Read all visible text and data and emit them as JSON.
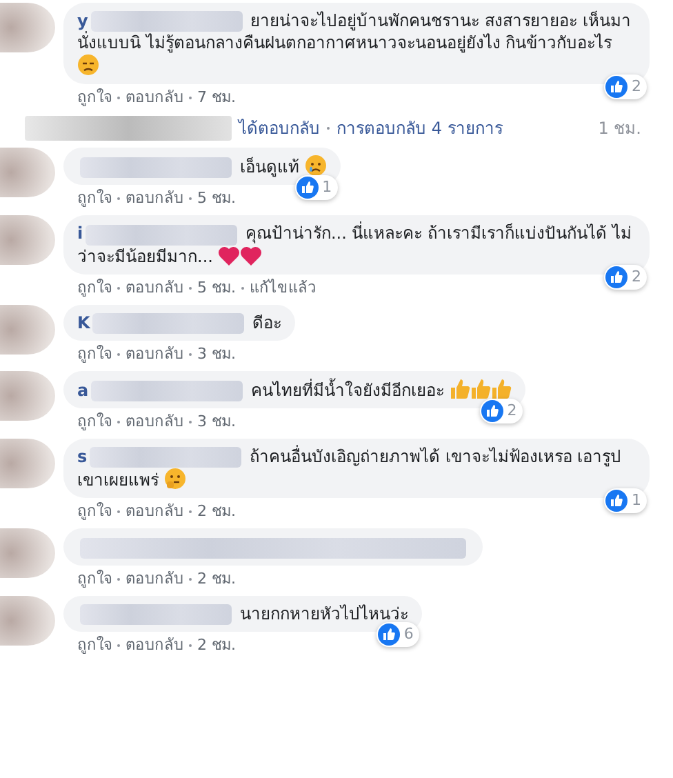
{
  "comments": [
    {
      "kind": "comment",
      "name_fragment": "y",
      "text": "ยายน่าจะไปอยู่บ้านพักคนชรานะ สงสารยายอะ เห็นมานั่งแบบนิ ไม่รู้ตอนกลางคืนฝนตกอากาศหนาวจะนอนอยู่ยังไง กินข้าวกับอะไร",
      "emojis": [
        {
          "kind": "sad"
        }
      ],
      "likes": "2",
      "actions": [
        "ถูกใจ",
        "ตอบกลับ"
      ],
      "time": "7 ชม."
    },
    {
      "kind": "replies",
      "text": "ได้ตอบกลับ",
      "count": "การตอบกลับ 4 รายการ",
      "time": "1 ชม."
    },
    {
      "kind": "comment",
      "text": "เอ็นดูแท้",
      "emojis": [
        {
          "kind": "crying"
        }
      ],
      "likes": "1",
      "actions": [
        "ถูกใจ",
        "ตอบกลับ"
      ],
      "time": "5 ชม."
    },
    {
      "kind": "comment",
      "name_fragment": "i",
      "text": "คุณป้าน่ารัก... นี่แหละคะ ถ้าเรามีเราก็แบ่งปันกันได้ ไม่ว่าจะมีน้อยมีมาก...",
      "emojis": [
        {
          "kind": "heart"
        },
        {
          "kind": "heart"
        }
      ],
      "likes": "2",
      "actions": [
        "ถูกใจ",
        "ตอบกลับ"
      ],
      "time": "5 ชม.",
      "edited": "แก้ไขแล้ว"
    },
    {
      "kind": "comment",
      "name_fragment": "K",
      "text": "ดีอะ",
      "actions": [
        "ถูกใจ",
        "ตอบกลับ"
      ],
      "time": "3 ชม."
    },
    {
      "kind": "comment",
      "name_fragment": "a",
      "text": "คนไทยที่มีน้ำใจยังมีอีกเยอะ",
      "emojis": [
        {
          "kind": "thumbs-up"
        },
        {
          "kind": "thumbs-up"
        },
        {
          "kind": "thumbs-up"
        }
      ],
      "likes": "2",
      "actions": [
        "ถูกใจ",
        "ตอบกลับ"
      ],
      "time": "3 ชม."
    },
    {
      "kind": "comment",
      "name_fragment": "s",
      "text": "ถ้าคนอื่นบังเอิญถ่ายภาพได้ เขาจะไม่ฟ้องเหรอ เอารูปเขาเผยแพร่",
      "emojis": [
        {
          "kind": "thinking"
        }
      ],
      "likes": "1",
      "actions": [
        "ถูกใจ",
        "ตอบกลับ"
      ],
      "time": "2 ชม."
    },
    {
      "kind": "redacted",
      "actions": [
        "ถูกใจ",
        "ตอบกลับ"
      ],
      "time": "2 ชม."
    },
    {
      "kind": "comment",
      "text": "นายกกหายหัวไปไหนว่ะ",
      "likes": "6",
      "actions": [
        "ถูกใจ",
        "ตอบกลับ"
      ],
      "time": "2 ชม."
    }
  ]
}
